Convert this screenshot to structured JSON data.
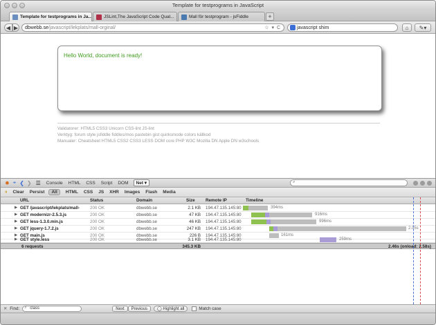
{
  "window": {
    "title": "Template for testprograms in JavaScript"
  },
  "tabs": [
    {
      "label": "Template for testprograms in Ja...",
      "favicon_color": "#6a8fbf",
      "active": true
    },
    {
      "label": "JSLint,The JavaScript Code Qual...",
      "favicon_color": "#b0304a",
      "active": false
    },
    {
      "label": "Mall för testprogram - jsFiddle",
      "favicon_color": "#4a7ab0",
      "active": false
    }
  ],
  "nav": {
    "url_host": "dbwebb.se",
    "url_path": "/javascript/lekplats/mall-orginal/",
    "search_value": "javascript shim"
  },
  "page": {
    "hello_text": "Hello World, document is ready!",
    "footer_lines": [
      "Validatorer: HTML5 CSS3 Unicorn CSS-lint JS-lint",
      "Verktyg: forum style jsfiddle fiddles/mos pastebin gist quirksmode colors källkod",
      "Manualer: Cheatsheet HTML5 CSS2 CSS3 LESS DOM core PHP W3C Mozilla DN Apple DN w3schools"
    ]
  },
  "firebug": {
    "panels": [
      "Console",
      "HTML",
      "CSS",
      "Script",
      "DOM"
    ],
    "net_label": "Net ▾",
    "filters": [
      "Clear",
      "Persist",
      "All",
      "HTML",
      "CSS",
      "JS",
      "XHR",
      "Images",
      "Flash",
      "Media"
    ],
    "columns": [
      "URL",
      "Status",
      "Domain",
      "Size",
      "Remote IP",
      "Timeline"
    ],
    "rows": [
      {
        "url": "GET /javascript/lekplats/mall-",
        "status": "200 OK",
        "domain": "dbwebb.se",
        "size": "2.1 KB",
        "ip": "194.47.135.145:80",
        "time": "394ms"
      },
      {
        "url": "GET modernizr-2.5.3.js",
        "status": "200 OK",
        "domain": "dbwebb.se",
        "size": "47 KB",
        "ip": "194.47.135.145:80",
        "time": "916ms"
      },
      {
        "url": "GET less-1.3.0.min.js",
        "status": "200 OK",
        "domain": "dbwebb.se",
        "size": "46 KB",
        "ip": "194.47.135.145:80",
        "time": "996ms"
      },
      {
        "url": "GET jquery-1.7.2.js",
        "status": "200 OK",
        "domain": "dbwebb.se",
        "size": "247 KB",
        "ip": "194.47.135.145:80",
        "time": "2.05s"
      },
      {
        "url": "GET main.js",
        "status": "200 OK",
        "domain": "dbwebb.se",
        "size": "226 B",
        "ip": "194.47.135.145:80",
        "time": "161ms"
      },
      {
        "url": "GET style.less",
        "status": "200 OK",
        "domain": "dbwebb.se",
        "size": "3.1 KB",
        "ip": "194.47.135.145:80",
        "time": "259ms"
      }
    ],
    "summary": {
      "requests": "6 requests",
      "total_size": "345.3 KB",
      "total_time": "2.46s (onload: 2.58s)"
    }
  },
  "find": {
    "label": "Find:",
    "value": "class",
    "next_label": "Next",
    "previous_label": "Previous",
    "highlight_label": "Highlight all",
    "match_case_label": "Match case"
  }
}
